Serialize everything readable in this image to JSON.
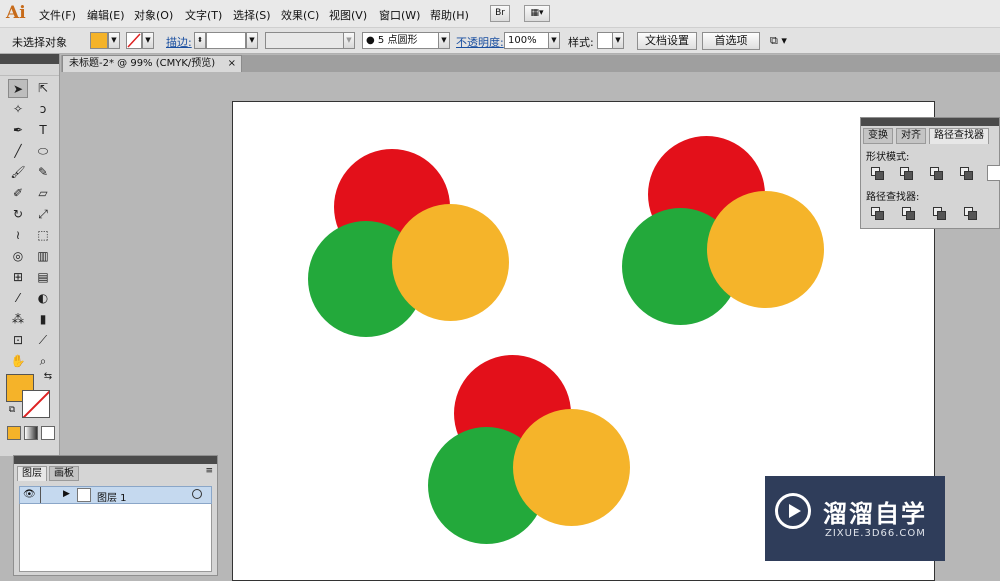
{
  "app": {
    "logo": "Ai"
  },
  "menu": {
    "items": [
      "文件(F)",
      "编辑(E)",
      "对象(O)",
      "文字(T)",
      "选择(S)",
      "效果(C)",
      "视图(V)",
      "窗口(W)",
      "帮助(H)"
    ],
    "bridge_label": "Br"
  },
  "control_bar": {
    "selection_status": "未选择对象",
    "stroke_label": "描边:",
    "brush_value": "5 点圆形",
    "opacity_label": "不透明度:",
    "opacity_value": "100%",
    "style_label": "样式:",
    "doc_setup_button": "文档设置",
    "preferences_button": "首选项",
    "fill_color": "#f5b329"
  },
  "document": {
    "tab_title": "未标题-2* @ 99% (CMYK/预览)",
    "close_glyph": "×"
  },
  "artboard": {
    "groups": [
      {
        "colors": [
          "#e3101a",
          "#23a93b",
          "#f5b42a"
        ]
      },
      {
        "colors": [
          "#e3101a",
          "#23a93b",
          "#f5b42a"
        ]
      },
      {
        "colors": [
          "#e3101a",
          "#23a93b",
          "#f5b42a"
        ]
      }
    ]
  },
  "pathfinder_panel": {
    "tabs": [
      "变换",
      "对齐",
      "路径查找器"
    ],
    "shape_modes_label": "形状模式:",
    "pathfinders_label": "路径查找器:"
  },
  "layers_panel": {
    "tabs": [
      "图层",
      "画板"
    ],
    "layer_name": "图层 1"
  },
  "watermark": {
    "title": "溜溜自学",
    "subtitle": "ZIXUE.3D66.COM"
  }
}
